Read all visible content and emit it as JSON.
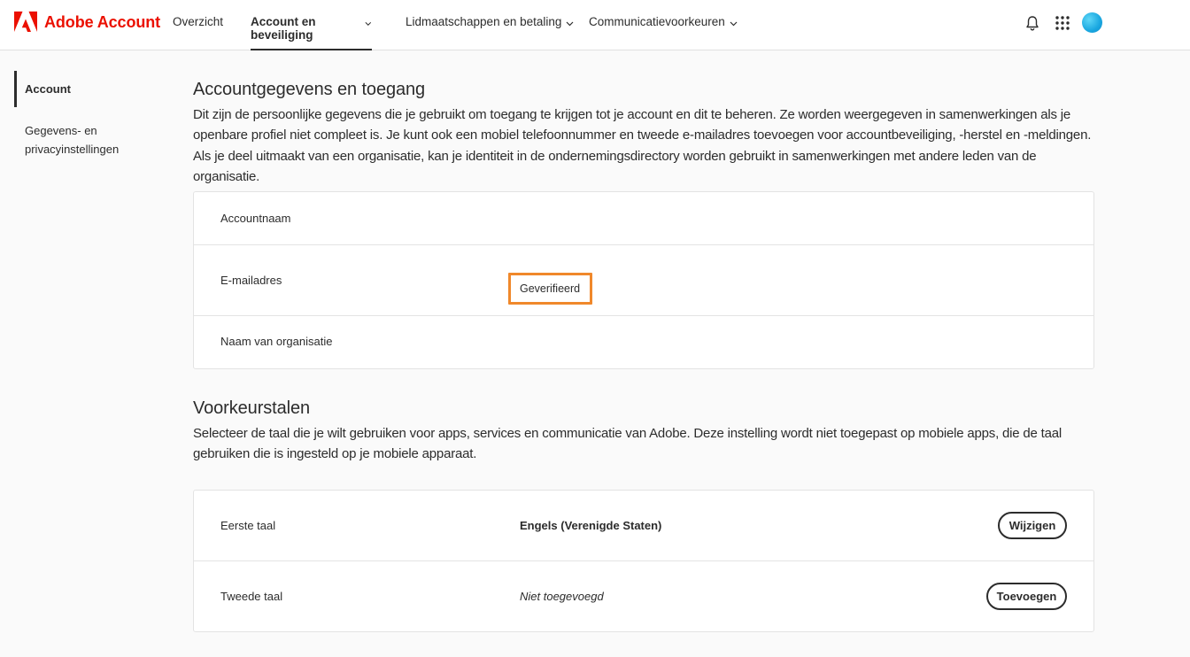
{
  "brand": {
    "name": "Adobe Account",
    "logo_color": "#eb1000"
  },
  "nav": {
    "overview": "Overzicht",
    "account_security": "Account en beveiliging",
    "memberships": "Lidmaatschappen en betaling",
    "communication": "Communicatievoorkeuren"
  },
  "top_icons": {
    "notifications": "bell-icon",
    "apps": "app-grid-icon",
    "avatar": "avatar"
  },
  "sidebar": {
    "items": [
      {
        "label": "Account",
        "active": true
      },
      {
        "label_line1": "Gegevens- en",
        "label_line2": "privacyinstellingen",
        "active": false
      }
    ]
  },
  "account_section": {
    "title": "Accountgegevens en toegang",
    "description": "Dit zijn de persoonlijke gegevens die je gebruikt om toegang te krijgen tot je account en dit te beheren. Ze worden weergegeven in samenwerkingen als je openbare profiel niet compleet is. Je kunt ook een mobiel telefoonnummer en tweede e-mailadres toevoegen voor accountbeveiliging, -herstel en -meldingen. Als je deel uitmaakt van een organisatie, kan je identiteit in de ondernemingsdirectory worden gebruikt in samenwerkingen met andere leden van de organisatie.",
    "rows": {
      "account_name_label": "Accountnaam",
      "email_label": "E-mailadres",
      "email_status": "Geverifieerd",
      "org_label": "Naam van organisatie"
    }
  },
  "language_section": {
    "title": "Voorkeurstalen",
    "description": "Selecteer de taal die je wilt gebruiken voor apps, services en communicatie van Adobe. Deze instelling wordt niet toegepast op mobiele apps, die de taal gebruiken die is ingesteld op je mobiele apparaat.",
    "rows": {
      "first_label": "Eerste taal",
      "first_value": "Engels (Verenigde Staten)",
      "first_button": "Wijzigen",
      "second_label": "Tweede taal",
      "second_value": "Niet toegevoegd",
      "second_button": "Toevoegen"
    }
  },
  "colors": {
    "highlight": "#f0882b",
    "avatar": "#1aa7e0"
  }
}
